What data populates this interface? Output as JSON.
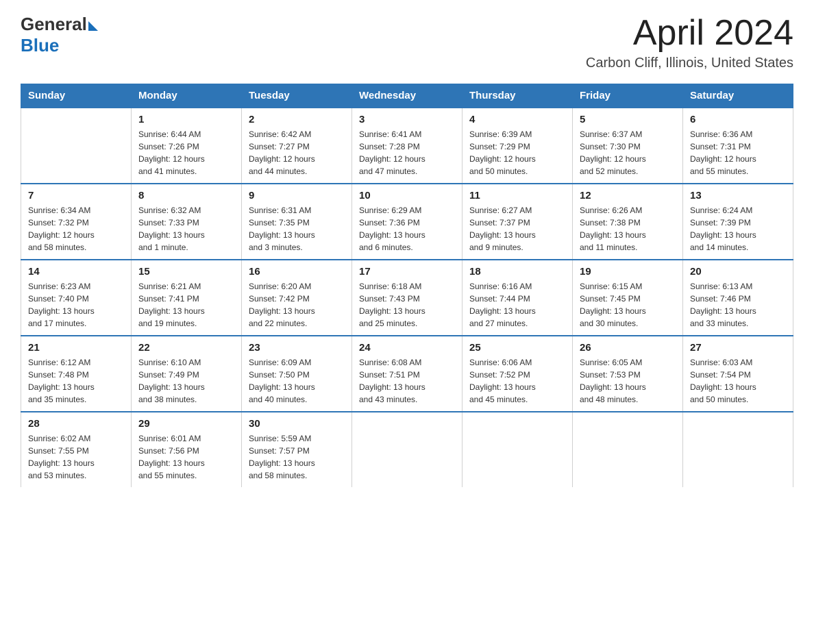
{
  "header": {
    "logo_general": "General",
    "logo_blue": "Blue",
    "month_year": "April 2024",
    "location": "Carbon Cliff, Illinois, United States"
  },
  "days_of_week": [
    "Sunday",
    "Monday",
    "Tuesday",
    "Wednesday",
    "Thursday",
    "Friday",
    "Saturday"
  ],
  "weeks": [
    [
      {
        "num": "",
        "info": ""
      },
      {
        "num": "1",
        "info": "Sunrise: 6:44 AM\nSunset: 7:26 PM\nDaylight: 12 hours\nand 41 minutes."
      },
      {
        "num": "2",
        "info": "Sunrise: 6:42 AM\nSunset: 7:27 PM\nDaylight: 12 hours\nand 44 minutes."
      },
      {
        "num": "3",
        "info": "Sunrise: 6:41 AM\nSunset: 7:28 PM\nDaylight: 12 hours\nand 47 minutes."
      },
      {
        "num": "4",
        "info": "Sunrise: 6:39 AM\nSunset: 7:29 PM\nDaylight: 12 hours\nand 50 minutes."
      },
      {
        "num": "5",
        "info": "Sunrise: 6:37 AM\nSunset: 7:30 PM\nDaylight: 12 hours\nand 52 minutes."
      },
      {
        "num": "6",
        "info": "Sunrise: 6:36 AM\nSunset: 7:31 PM\nDaylight: 12 hours\nand 55 minutes."
      }
    ],
    [
      {
        "num": "7",
        "info": "Sunrise: 6:34 AM\nSunset: 7:32 PM\nDaylight: 12 hours\nand 58 minutes."
      },
      {
        "num": "8",
        "info": "Sunrise: 6:32 AM\nSunset: 7:33 PM\nDaylight: 13 hours\nand 1 minute."
      },
      {
        "num": "9",
        "info": "Sunrise: 6:31 AM\nSunset: 7:35 PM\nDaylight: 13 hours\nand 3 minutes."
      },
      {
        "num": "10",
        "info": "Sunrise: 6:29 AM\nSunset: 7:36 PM\nDaylight: 13 hours\nand 6 minutes."
      },
      {
        "num": "11",
        "info": "Sunrise: 6:27 AM\nSunset: 7:37 PM\nDaylight: 13 hours\nand 9 minutes."
      },
      {
        "num": "12",
        "info": "Sunrise: 6:26 AM\nSunset: 7:38 PM\nDaylight: 13 hours\nand 11 minutes."
      },
      {
        "num": "13",
        "info": "Sunrise: 6:24 AM\nSunset: 7:39 PM\nDaylight: 13 hours\nand 14 minutes."
      }
    ],
    [
      {
        "num": "14",
        "info": "Sunrise: 6:23 AM\nSunset: 7:40 PM\nDaylight: 13 hours\nand 17 minutes."
      },
      {
        "num": "15",
        "info": "Sunrise: 6:21 AM\nSunset: 7:41 PM\nDaylight: 13 hours\nand 19 minutes."
      },
      {
        "num": "16",
        "info": "Sunrise: 6:20 AM\nSunset: 7:42 PM\nDaylight: 13 hours\nand 22 minutes."
      },
      {
        "num": "17",
        "info": "Sunrise: 6:18 AM\nSunset: 7:43 PM\nDaylight: 13 hours\nand 25 minutes."
      },
      {
        "num": "18",
        "info": "Sunrise: 6:16 AM\nSunset: 7:44 PM\nDaylight: 13 hours\nand 27 minutes."
      },
      {
        "num": "19",
        "info": "Sunrise: 6:15 AM\nSunset: 7:45 PM\nDaylight: 13 hours\nand 30 minutes."
      },
      {
        "num": "20",
        "info": "Sunrise: 6:13 AM\nSunset: 7:46 PM\nDaylight: 13 hours\nand 33 minutes."
      }
    ],
    [
      {
        "num": "21",
        "info": "Sunrise: 6:12 AM\nSunset: 7:48 PM\nDaylight: 13 hours\nand 35 minutes."
      },
      {
        "num": "22",
        "info": "Sunrise: 6:10 AM\nSunset: 7:49 PM\nDaylight: 13 hours\nand 38 minutes."
      },
      {
        "num": "23",
        "info": "Sunrise: 6:09 AM\nSunset: 7:50 PM\nDaylight: 13 hours\nand 40 minutes."
      },
      {
        "num": "24",
        "info": "Sunrise: 6:08 AM\nSunset: 7:51 PM\nDaylight: 13 hours\nand 43 minutes."
      },
      {
        "num": "25",
        "info": "Sunrise: 6:06 AM\nSunset: 7:52 PM\nDaylight: 13 hours\nand 45 minutes."
      },
      {
        "num": "26",
        "info": "Sunrise: 6:05 AM\nSunset: 7:53 PM\nDaylight: 13 hours\nand 48 minutes."
      },
      {
        "num": "27",
        "info": "Sunrise: 6:03 AM\nSunset: 7:54 PM\nDaylight: 13 hours\nand 50 minutes."
      }
    ],
    [
      {
        "num": "28",
        "info": "Sunrise: 6:02 AM\nSunset: 7:55 PM\nDaylight: 13 hours\nand 53 minutes."
      },
      {
        "num": "29",
        "info": "Sunrise: 6:01 AM\nSunset: 7:56 PM\nDaylight: 13 hours\nand 55 minutes."
      },
      {
        "num": "30",
        "info": "Sunrise: 5:59 AM\nSunset: 7:57 PM\nDaylight: 13 hours\nand 58 minutes."
      },
      {
        "num": "",
        "info": ""
      },
      {
        "num": "",
        "info": ""
      },
      {
        "num": "",
        "info": ""
      },
      {
        "num": "",
        "info": ""
      }
    ]
  ]
}
